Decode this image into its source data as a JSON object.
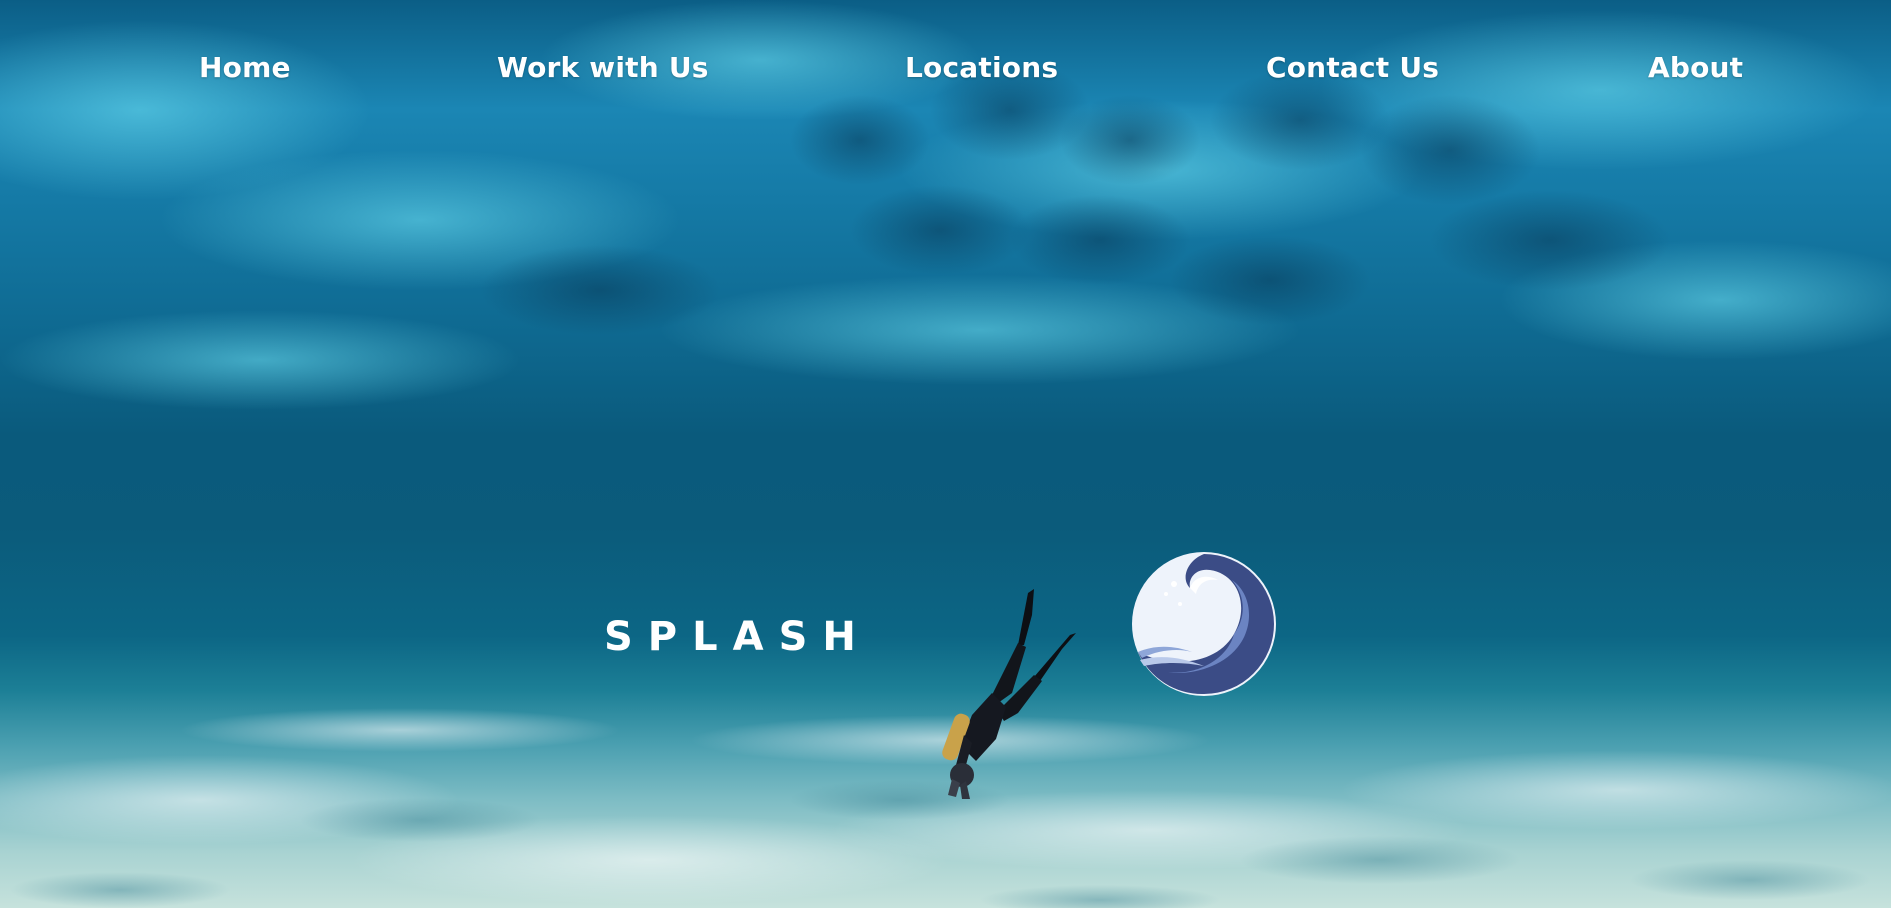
{
  "nav": {
    "items": [
      {
        "label": "Home"
      },
      {
        "label": "Work with Us"
      },
      {
        "label": "Locations"
      },
      {
        "label": "Contact Us"
      },
      {
        "label": "About"
      }
    ]
  },
  "hero": {
    "brand": "SPLASH",
    "logo_icon": "wave-icon",
    "figure": "scuba-diver"
  },
  "colors": {
    "nav_text": "#ffffff",
    "water_surface": "#1b86b4",
    "deep_water": "#0a5a7c",
    "sand": "#c6e2dc"
  }
}
